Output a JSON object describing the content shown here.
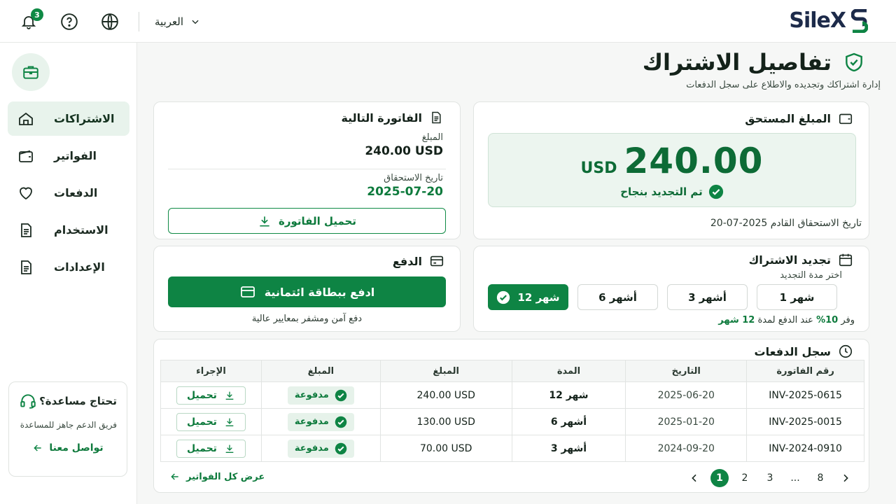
{
  "brand": {
    "name": "SileX",
    "accent": "#0e8444",
    "dark": "#1d2b4a"
  },
  "topbar": {
    "notifications_count": "3",
    "language": "العربية",
    "icons": [
      "bell-icon",
      "help-icon",
      "globe-icon",
      "chevron-down-icon"
    ]
  },
  "sidebar": {
    "items": [
      {
        "label": "الاشتراكات",
        "icon": "home-icon",
        "active": true
      },
      {
        "label": "الفواتير",
        "icon": "wallet-icon"
      },
      {
        "label": "الدفعات",
        "icon": "heart-icon"
      },
      {
        "label": "الاستخدام",
        "icon": "document-icon"
      },
      {
        "label": "الإعدادات",
        "icon": "document-icon"
      }
    ],
    "help": {
      "title": "تحتاج مساعدة؟",
      "subtitle": "فريق الدعم جاهز للمساعدة",
      "link": "تواصل معنا"
    }
  },
  "page": {
    "title": "تفاصيل الاشتراك",
    "subtitle": "إدارة اشتراكك وتجديده والاطلاع على سجل الدفعات"
  },
  "amount_due": {
    "title": "المبلغ المستحق",
    "amount": "240.00",
    "currency": "USD",
    "status": "تم التجديد بنجاح",
    "next_due": "تاريخ الاستحقاق القادم 2025-07-20"
  },
  "next_invoice": {
    "title": "الفاتورة التالية",
    "amount_label": "المبلغ",
    "amount": "240.00 USD",
    "due_label": "تاريخ الاستحقاق",
    "due_date": "2025-07-20",
    "download": "تحميل الفاتورة"
  },
  "renewal": {
    "title": "تجديد الاشتراك",
    "subtitle": "اختر مدة التجديد",
    "options": [
      "12 شهر",
      "6 أشهر",
      "3 أشهر",
      "1 شهر"
    ],
    "selected_index": 0,
    "save_prefix": "وفر",
    "save_percent": "10%",
    "save_mid": "عند الدفع لمدة",
    "save_period": "12 شهر"
  },
  "payment": {
    "title": "الدفع",
    "button": "ادفع ببطاقة ائتمانية",
    "note": "دفع آمن ومشفر بمعايير عالية"
  },
  "history": {
    "title": "سجل الدفعات",
    "columns": [
      "الإجراء",
      "المبلغ",
      "المبلغ",
      "المدة",
      "التاريخ",
      "رقم الفاتورة"
    ],
    "rows": [
      {
        "status": "مدفوعة",
        "amount": "240.00 USD",
        "period": "12 شهر",
        "date": "2025-06-20",
        "invoice": "INV-2025-0615",
        "action": "تحميل"
      },
      {
        "status": "مدفوعة",
        "amount": "130.00 USD",
        "period": "6 أشهر",
        "date": "2025-01-20",
        "invoice": "INV-2025-0015",
        "action": "تحميل"
      },
      {
        "status": "مدفوعة",
        "amount": "70.00 USD",
        "period": "3 أشهر",
        "date": "2024-09-20",
        "invoice": "INV-2024-0910",
        "action": "تحميل"
      }
    ],
    "view_all": "عرض كل الفواتير",
    "pagination": {
      "pages": [
        "1",
        "2",
        "3",
        "...",
        "8"
      ],
      "current": "1"
    }
  }
}
